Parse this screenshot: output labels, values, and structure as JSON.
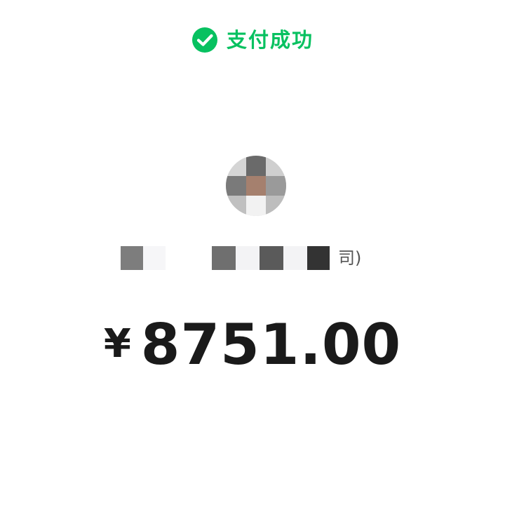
{
  "status": {
    "icon": "check-icon",
    "text": "支付成功",
    "accent": "#07c160"
  },
  "payee": {
    "name_suffix": "司)",
    "avatar_tones": [
      "#d5d5d5",
      "#6a6a6a",
      "#cfcfcf",
      "#7a7a7a",
      "#a5806e",
      "#9a9a9a",
      "#c0c0c0",
      "#f2f2f2",
      "#bdbdbd"
    ]
  },
  "payment": {
    "currency": "¥",
    "amount": "8751.00",
    "color": "#1a1a1a"
  }
}
